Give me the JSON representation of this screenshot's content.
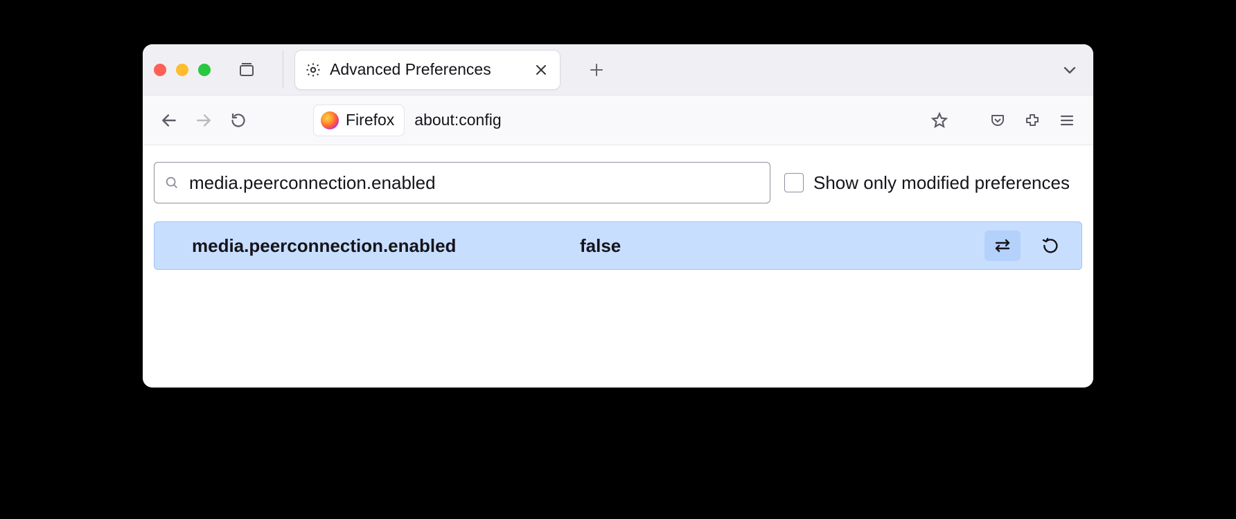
{
  "tab": {
    "title": "Advanced Preferences"
  },
  "addressbar": {
    "chip_label": "Firefox",
    "url": "about:config"
  },
  "config": {
    "search_value": "media.peerconnection.enabled",
    "checkbox_label": "Show only modified preferences",
    "preference": {
      "name": "media.peerconnection.enabled",
      "value": "false"
    }
  }
}
